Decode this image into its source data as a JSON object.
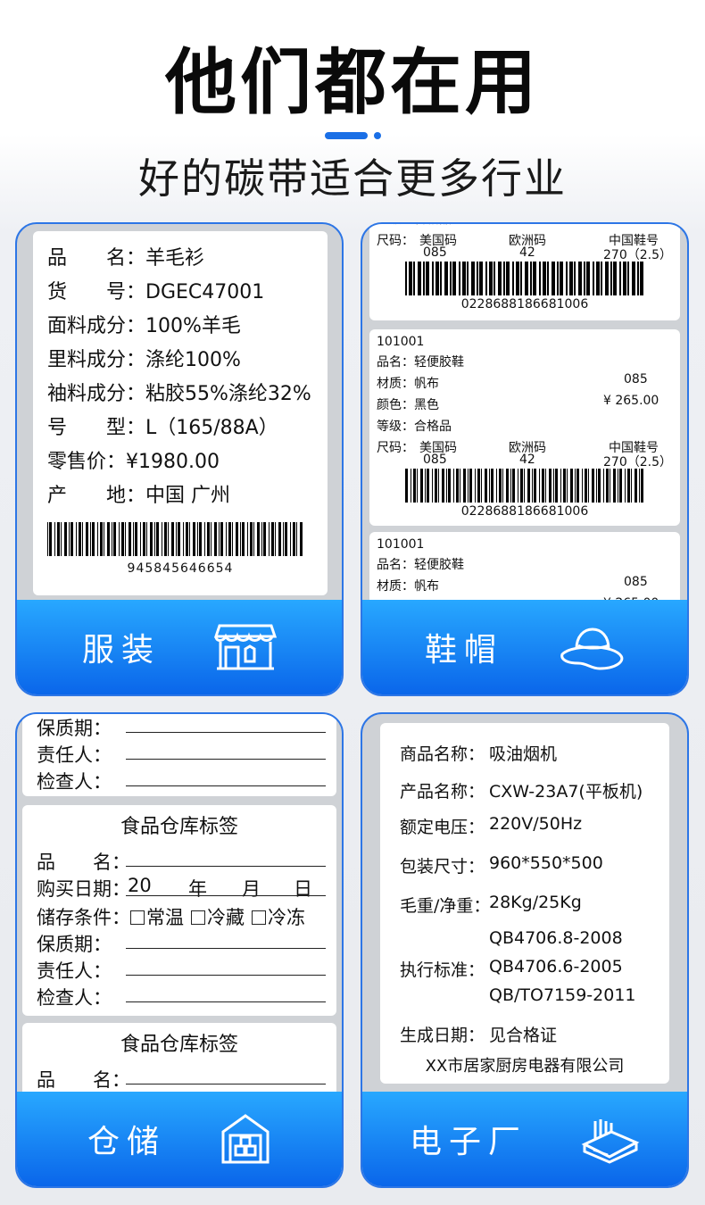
{
  "header": {
    "title": "他们都在用",
    "subtitle": "好的碳带适合更多行业"
  },
  "colors": {
    "accent": "#1a6fe6",
    "footer_top": "#28a8ff",
    "footer_bottom": "#0a66ea"
  },
  "clothing": {
    "rows": [
      {
        "k": "品　　名：",
        "v": "羊毛衫"
      },
      {
        "k": "货　　号：",
        "v": "DGEC47001"
      },
      {
        "k": "面料成分：",
        "v": "100%羊毛"
      },
      {
        "k": "里料成分：",
        "v": "涤纶100%"
      },
      {
        "k": "袖料成分：",
        "v": "粘胶55%涤纶32%"
      },
      {
        "k": "号　　型：",
        "v": "L（165/88A）"
      },
      {
        "k": "零售价：",
        "v": "¥1980.00"
      },
      {
        "k": "产　　地：",
        "v": "中国 广州"
      }
    ],
    "barcode": "945845646654",
    "label": "服装",
    "icon": "shop-icon"
  },
  "shoes": {
    "top_cut": "等级：合格品",
    "code": "101001",
    "name_k": "品名：",
    "name_v": "轻便胶鞋",
    "material_k": "材质：",
    "material_v": "帆布",
    "size_code": "085",
    "color_k": "颜色：",
    "color_v": "黑色",
    "price": "¥ 265.00",
    "grade_k": "等级：",
    "grade_v": "合格品",
    "size_k": "尺码：",
    "us": "美国码",
    "eu": "欧洲码",
    "cn": "中国鞋号",
    "us_v": "085",
    "eu_v": "42",
    "cn_v": "270（2.5）",
    "barcode": "0228688186681006",
    "label": "鞋帽",
    "icon": "hat-icon"
  },
  "warehouse": {
    "top": {
      "shelf": "保质期：",
      "person": "责任人：",
      "checker": "检查人："
    },
    "title": "食品仓库标签",
    "name_k": "品　　名：",
    "buy_k": "购买日期：",
    "buy_v": "20",
    "year": "年",
    "month": "月",
    "day": "日",
    "store_k": "储存条件：",
    "opt1": "常温",
    "opt2": "冷藏",
    "opt3": "冷冻",
    "shelf_k": "保质期：",
    "person_k": "责任人：",
    "checker_k": "检查人：",
    "label": "仓储",
    "icon": "warehouse-icon"
  },
  "electronics": {
    "rows": [
      {
        "k": "商品名称：",
        "v": "吸油烟机"
      },
      {
        "k": "产品名称：",
        "v": "CXW-23A7(平板机)"
      },
      {
        "k": "额定电压：",
        "v": "220V/50Hz"
      },
      {
        "k": "包装尺寸：",
        "v": "960*550*500"
      },
      {
        "k": "毛重/净重：",
        "v": "28Kg/25Kg"
      }
    ],
    "std_k": "执行标准：",
    "std1": "QB4706.8-2008",
    "std2": "QB4706.6-2005",
    "std3": "QB/TO7159-2011",
    "date_k": "生成日期：",
    "date_v": "见合格证",
    "company": "XX市居家厨房电器有限公司",
    "label": "电子厂",
    "icon": "factory-icon"
  }
}
